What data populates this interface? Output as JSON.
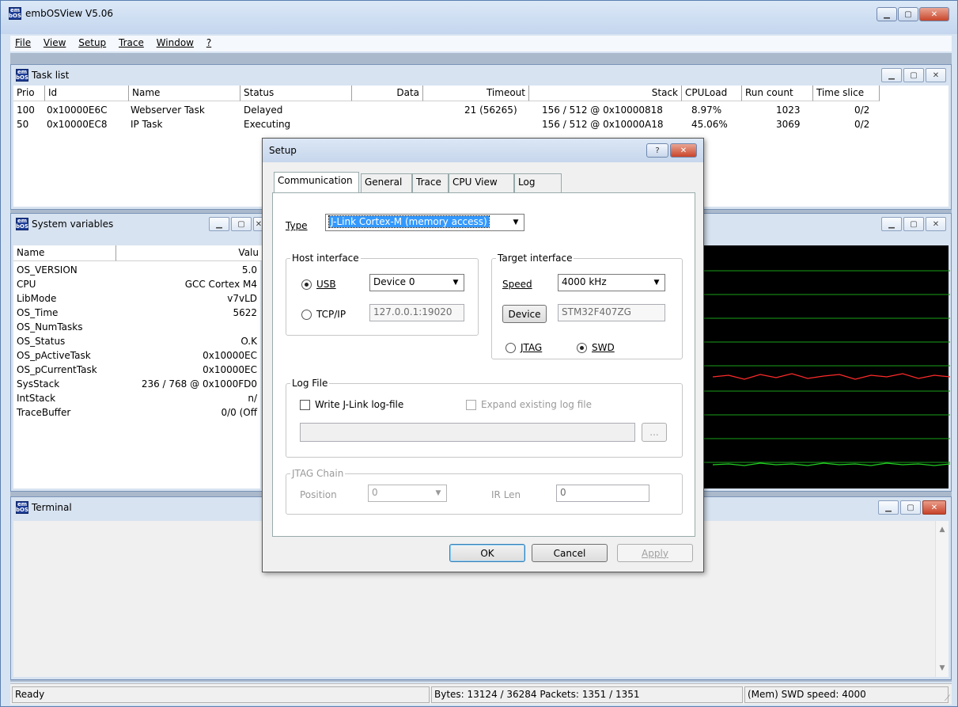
{
  "app": {
    "title": "embOSView V5.06",
    "logo_text": "em\nbOS",
    "accent": "#1d3d96"
  },
  "menubar": [
    {
      "label": "File"
    },
    {
      "label": "View"
    },
    {
      "label": "Setup"
    },
    {
      "label": "Trace"
    },
    {
      "label": "Window"
    },
    {
      "label": "?"
    }
  ],
  "tasklist": {
    "title": "Task list",
    "headers": [
      "Prio",
      "Id",
      "Name",
      "Status",
      "Data",
      "Timeout",
      "Stack",
      "CPULoad",
      "Run count",
      "Time slice"
    ],
    "rows": [
      [
        "100",
        "0x10000E6C",
        "Webserver Task",
        "Delayed",
        "",
        "21 (56265)",
        "156 / 512 @ 0x10000818",
        "8.97%",
        "1023",
        "0/2"
      ],
      [
        "50",
        "0x10000EC8",
        "IP Task",
        "Executing",
        "",
        "",
        "156 / 512 @ 0x10000A18",
        "45.06%",
        "3069",
        "0/2"
      ]
    ]
  },
  "sysvars": {
    "title": "System variables",
    "headers": [
      "Name",
      "Valu"
    ],
    "rows": [
      [
        "OS_VERSION",
        "5.0"
      ],
      [
        "CPU",
        "GCC Cortex M4"
      ],
      [
        "LibMode",
        "v7vLD"
      ],
      [
        "OS_Time",
        "5622"
      ],
      [
        "OS_NumTasks",
        ""
      ],
      [
        "OS_Status",
        "O.K"
      ],
      [
        "OS_pActiveTask",
        "0x10000EC"
      ],
      [
        "OS_pCurrentTask",
        "0x10000EC"
      ],
      [
        "SysStack",
        "236 / 768 @ 0x1000FD0"
      ],
      [
        "IntStack",
        "n/"
      ],
      [
        "TraceBuffer",
        "0/0  (Off"
      ]
    ]
  },
  "terminal": {
    "title": "Terminal"
  },
  "statusbar": {
    "ready": "Ready",
    "bytes": "Bytes: 13124 / 36284  Packets: 1351 / 1351",
    "speed": "(Mem) SWD speed: 4000"
  },
  "dialog": {
    "title": "Setup",
    "help": "?",
    "close": "✕",
    "tabs": [
      "Communication",
      "General",
      "Trace",
      "CPU View",
      "Log"
    ],
    "type_label": "Type",
    "type_value": "J-Link Cortex-M (memory access)",
    "host": {
      "label": "Host interface",
      "usb_label": "USB",
      "usb_device": "Device 0",
      "tcp_label": "TCP/IP",
      "tcp_value": "127.0.0.1:19020"
    },
    "target": {
      "label": "Target interface",
      "speed_label": "Speed",
      "speed_value": "4000 kHz",
      "device_button": "Device",
      "device_value": "STM32F407ZG",
      "jtag_label": "JTAG",
      "swd_label": "SWD"
    },
    "logfile": {
      "label": "Log File",
      "write_label": "Write J-Link log-file",
      "expand_label": "Expand existing log file",
      "path_value": "",
      "browse": "..."
    },
    "jtag_chain": {
      "label": "JTAG Chain",
      "position_label": "Position",
      "position_value": "0",
      "irlen_label": "IR Len",
      "irlen_value": "0"
    },
    "buttons": {
      "ok": "OK",
      "cancel": "Cancel",
      "apply": "Apply"
    }
  }
}
